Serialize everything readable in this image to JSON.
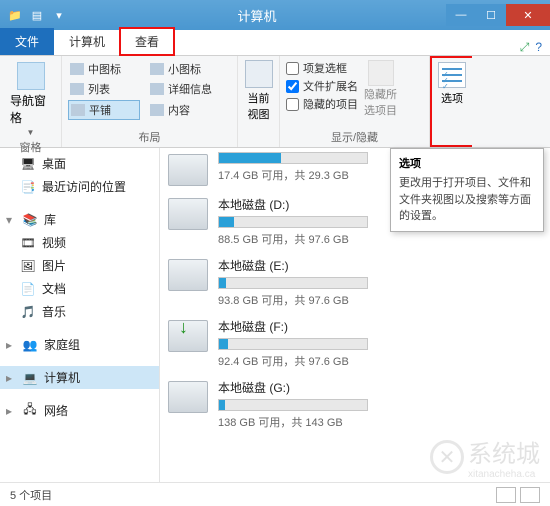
{
  "window": {
    "title": "计算机"
  },
  "tabs": {
    "file": "文件",
    "computer": "计算机",
    "view": "查看"
  },
  "ribbon": {
    "nav_pane": "导航窗格",
    "group_panes": "窗格",
    "layout": {
      "medium_icons": "中图标",
      "small_icons": "小图标",
      "list": "列表",
      "details": "详细信息",
      "tiles": "平铺",
      "content": "内容"
    },
    "group_layout": "布局",
    "current_view": "当前\n视图",
    "checks": {
      "item_checkboxes": "项复选框",
      "file_ext": "文件扩展名",
      "hidden_items": "隐藏的项目",
      "file_ext_checked": true
    },
    "hide_selected": "隐藏所\n选项目",
    "group_showhide": "显示/隐藏",
    "options": "选项"
  },
  "tooltip": {
    "title": "选项",
    "body": "更改用于打开项目、文件和文件夹视图以及搜索等方面的设置。"
  },
  "nav": {
    "desktop": "桌面",
    "recent": "最近访问的位置",
    "libraries": "库",
    "videos": "视频",
    "pictures": "图片",
    "documents": "文档",
    "music": "音乐",
    "homegroup": "家庭组",
    "computer": "计算机",
    "network": "网络"
  },
  "drives": [
    {
      "name": "",
      "free": "17.4 GB 可用，共 29.3 GB",
      "pct": 42
    },
    {
      "name": "本地磁盘 (D:)",
      "free": "88.5 GB 可用，共 97.6 GB",
      "pct": 10
    },
    {
      "name": "本地磁盘 (E:)",
      "free": "93.8 GB 可用，共 97.6 GB",
      "pct": 5
    },
    {
      "name": "本地磁盘 (F:)",
      "free": "92.4 GB 可用，共 97.6 GB",
      "pct": 6,
      "dl": true
    },
    {
      "name": "本地磁盘 (G:)",
      "free": "138 GB 可用，共 143 GB",
      "pct": 4
    }
  ],
  "status": {
    "count": "5 个项目"
  },
  "watermark": {
    "text": "系统城",
    "url": "xitanacheha.ca"
  }
}
